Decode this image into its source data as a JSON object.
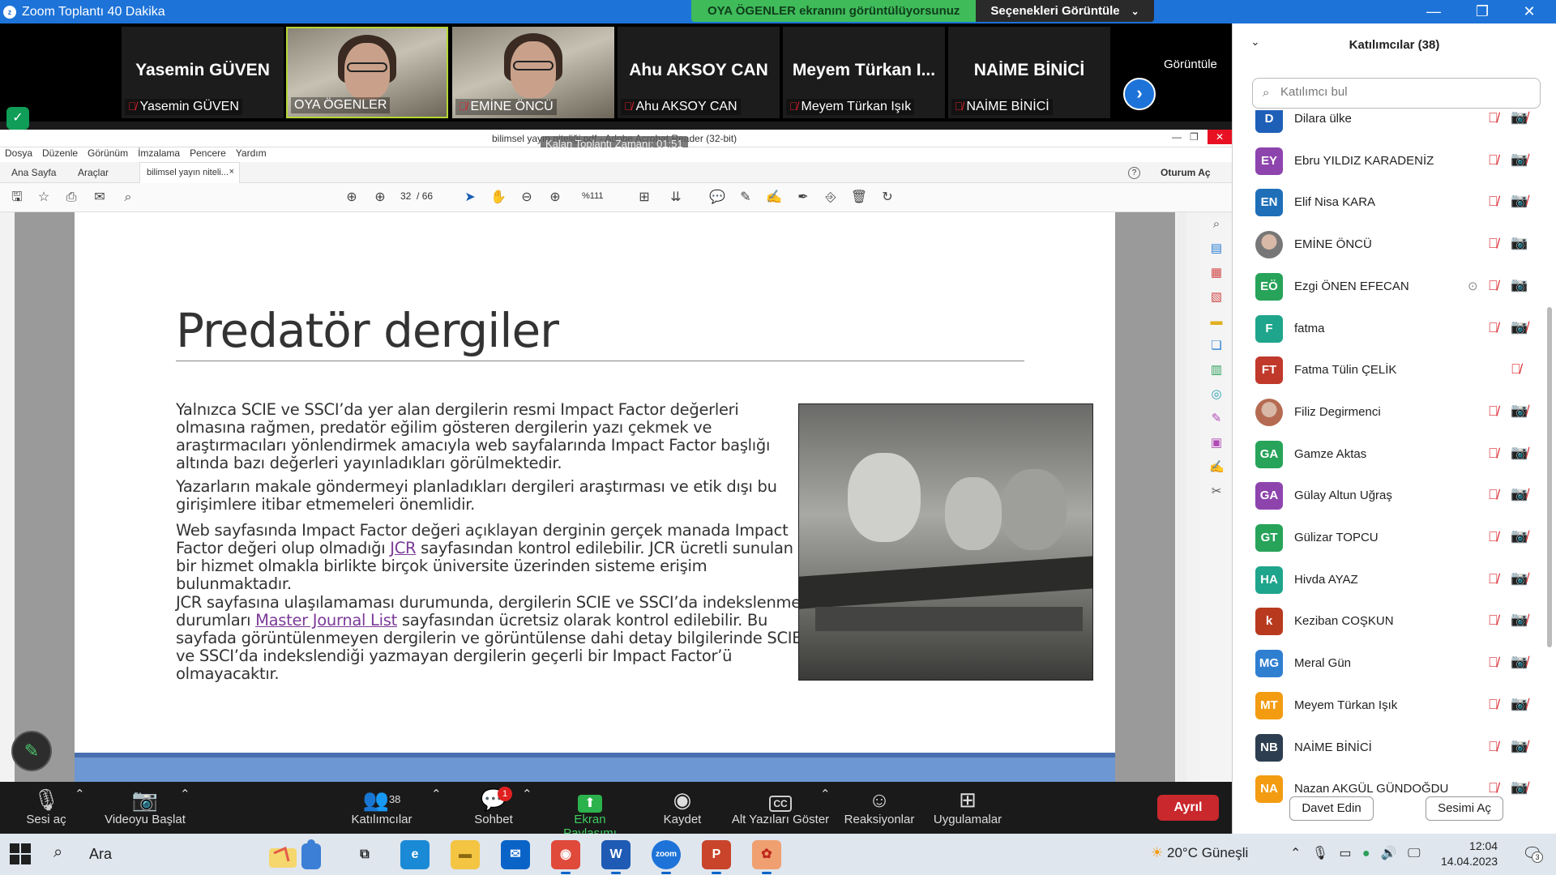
{
  "window": {
    "title": "Zoom Toplantı 40 Dakika",
    "share_banner": "OYA ÖGENLER ekranını görüntülüyorsunuz",
    "view_options": "Seçenekleri Görüntüle",
    "minimize": "—",
    "restore": "❐",
    "close": "✕"
  },
  "videostrip": {
    "view_label": "Görüntüle",
    "tiles": [
      {
        "big_name": "Yasemin GÜVEN",
        "label": "Yasemin GÜVEN",
        "muted": true,
        "video": false
      },
      {
        "big_name": "",
        "label": "OYA ÖGENLER",
        "muted": false,
        "video": true,
        "active": true
      },
      {
        "big_name": "",
        "label": "EMİNE ÖNCÜ",
        "muted": true,
        "video": true
      },
      {
        "big_name": "Ahu AKSOY CAN",
        "label": "Ahu AKSOY CAN",
        "muted": true,
        "video": false
      },
      {
        "big_name": "Meyem Türkan I...",
        "label": "Meyem Türkan Işık",
        "muted": true,
        "video": false
      },
      {
        "big_name": "NAİME BİNİCİ",
        "label": "NAİME BİNİCİ",
        "muted": true,
        "video": false
      }
    ]
  },
  "acrobat": {
    "title": "bilimsel yayın niteliği.pdf - Adobe Acrobat Reader (32-bit)",
    "recording": "Kalan Toplantı Zamanı: 01:51",
    "menu": [
      "Dosya",
      "Düzenle",
      "Görünüm",
      "İmzalama",
      "Pencere",
      "Yardım"
    ],
    "tabs": {
      "home": "Ana Sayfa",
      "tools": "Araçlar",
      "doc": "bilimsel yayın niteli...",
      "doc_close": "×",
      "help": "?",
      "signin": "Oturum Aç"
    },
    "page_current": "32",
    "page_total": "/ 66",
    "zoom": "%111"
  },
  "slide": {
    "title": "Predatör dergiler",
    "p1": "Yalnızca SCIE ve SSCI’da yer alan dergilerin resmi Impact Factor değerleri olmasına rağmen, predatör eğilim gösteren dergilerin yazı çekmek ve araştırmacıları yönlendirmek amacıyla web sayfalarında Impact Factor başlığı altında bazı değerleri yayınladıkları görülmektedir.",
    "p2": "Yazarların makale göndermeyi planladıkları dergileri araştırması ve etik dışı bu girişimlere itibar etmemeleri önemlidir.",
    "p3_a": "Web sayfasında Impact Factor değeri açıklayan derginin gerçek manada Impact Factor değeri olup olmadığı ",
    "p3_link": "JCR",
    "p3_b": " sayfasından kontrol edilebilir. JCR ücretli sunulan bir hizmet olmakla birlikte birçok üniversite üzerinden sisteme erişim bulunmaktadır.",
    "p4_a": "JCR sayfasına ulaşılamaması durumunda, dergilerin SCIE ve SSCI’da indekslenme durumları ",
    "p4_link": "Master Journal List",
    "p4_b": " sayfasından ücretsiz olarak kontrol edilebilir. Bu sayfada görüntülenmeyen dergilerin ve görüntülense dahi detay bilgilerinde SCIE ve SSCI’da indekslendiği yazmayan dergilerin geçerli bir Impact Factor’ü olmayacaktır."
  },
  "bottombar": {
    "audio": "Sesi aç",
    "video": "Videoyu Başlat",
    "participants": "Katılımcılar",
    "participants_count": "38",
    "chat": "Sohbet",
    "chat_badge": "1",
    "share": "Ekran Paylaşımı",
    "record": "Kaydet",
    "captions": "Alt Yazıları Göster",
    "reactions": "Reaksiyonlar",
    "apps": "Uygulamalar",
    "leave": "Ayrıl"
  },
  "panel": {
    "title": "Katılımcılar (38)",
    "search_placeholder": "Katılımcı bul",
    "participants": [
      {
        "initials": "D",
        "name": "Dilara ülke",
        "color": "#1e5fb8",
        "mic_muted": true,
        "cam_off": true
      },
      {
        "initials": "EY",
        "name": "Ebru YILDIZ KARADENİZ",
        "color": "#8e44ad",
        "mic_muted": true,
        "cam_off": true
      },
      {
        "initials": "EN",
        "name": "Elif Nisa KARA",
        "color": "#1e6fb8",
        "mic_muted": true,
        "cam_off": true
      },
      {
        "initials": "",
        "name": "EMİNE ÖNCÜ",
        "color": "#777777",
        "photo": true,
        "mic_muted": true,
        "cam_off": false
      },
      {
        "initials": "EÖ",
        "name": "Ezgi ÖNEN EFECAN",
        "color": "#27a35a",
        "mic_muted": true,
        "cam_off": false,
        "raise": true
      },
      {
        "initials": "F",
        "name": "fatma",
        "color": "#1fa58c",
        "mic_muted": true,
        "cam_off": true
      },
      {
        "initials": "FT",
        "name": "Fatma Tülin ÇELİK",
        "color": "#c0392b",
        "mic_muted": true,
        "cam_off": false,
        "no_cam": true
      },
      {
        "initials": "",
        "name": "Filiz Degirmenci",
        "color": "#b56b52",
        "photo": true,
        "mic_muted": true,
        "cam_off": true
      },
      {
        "initials": "GA",
        "name": "Gamze Aktas",
        "color": "#27a35a",
        "mic_muted": true,
        "cam_off": true
      },
      {
        "initials": "GA",
        "name": "Gülay Altun Uğraş",
        "color": "#8e44ad",
        "mic_muted": true,
        "cam_off": true
      },
      {
        "initials": "GT",
        "name": "Gülizar TOPCU",
        "color": "#27a35a",
        "mic_muted": true,
        "cam_off": true
      },
      {
        "initials": "HA",
        "name": "Hivda AYAZ",
        "color": "#1fa58c",
        "mic_muted": true,
        "cam_off": true
      },
      {
        "initials": "k",
        "name": "Keziban COŞKUN",
        "color": "#b83a1e",
        "mic_muted": true,
        "cam_off": true
      },
      {
        "initials": "MG",
        "name": "Meral Gün",
        "color": "#2f7fd1",
        "mic_muted": true,
        "cam_off": true
      },
      {
        "initials": "MT",
        "name": "Meyem Türkan Işık",
        "color": "#f39c12",
        "mic_muted": true,
        "cam_off": true
      },
      {
        "initials": "NB",
        "name": "NAİME BİNİCİ",
        "color": "#2c3e50",
        "mic_muted": true,
        "cam_off": true
      },
      {
        "initials": "NA",
        "name": "Nazan AKGÜL GÜNDOĞDU",
        "color": "#f39c12",
        "mic_muted": true,
        "cam_off": true
      }
    ],
    "invite": "Davet Edin",
    "unmute_me": "Sesimi Aç"
  },
  "taskbar": {
    "search": "Ara",
    "weather": "20°C  Güneşli",
    "time": "12:04",
    "date": "14.04.2023",
    "notifications": "3",
    "apps": [
      {
        "name": "task-view-icon",
        "glyph": "⧉",
        "color": "#dfe6ee",
        "fg": "#222"
      },
      {
        "name": "edge-icon",
        "glyph": "e",
        "color": "#1b8ad6",
        "fg": "#fff"
      },
      {
        "name": "file-explorer-icon",
        "glyph": "▬",
        "color": "#f4c542",
        "fg": "#8a6a10"
      },
      {
        "name": "mail-icon",
        "glyph": "✉",
        "color": "#0a64c8",
        "fg": "#fff"
      },
      {
        "name": "chrome-icon",
        "glyph": "◉",
        "color": "#e04a3a",
        "fg": "#fff"
      },
      {
        "name": "word-icon",
        "glyph": "W",
        "color": "#1f5bb4",
        "fg": "#fff"
      },
      {
        "name": "zoom-icon",
        "glyph": "zoom",
        "color": "#1d73d8",
        "fg": "#fff"
      },
      {
        "name": "powerpoint-icon",
        "glyph": "P",
        "color": "#c9442a",
        "fg": "#fff"
      },
      {
        "name": "acrobat-icon",
        "glyph": "✿",
        "color": "#f0a070",
        "fg": "#c0281c"
      }
    ]
  }
}
